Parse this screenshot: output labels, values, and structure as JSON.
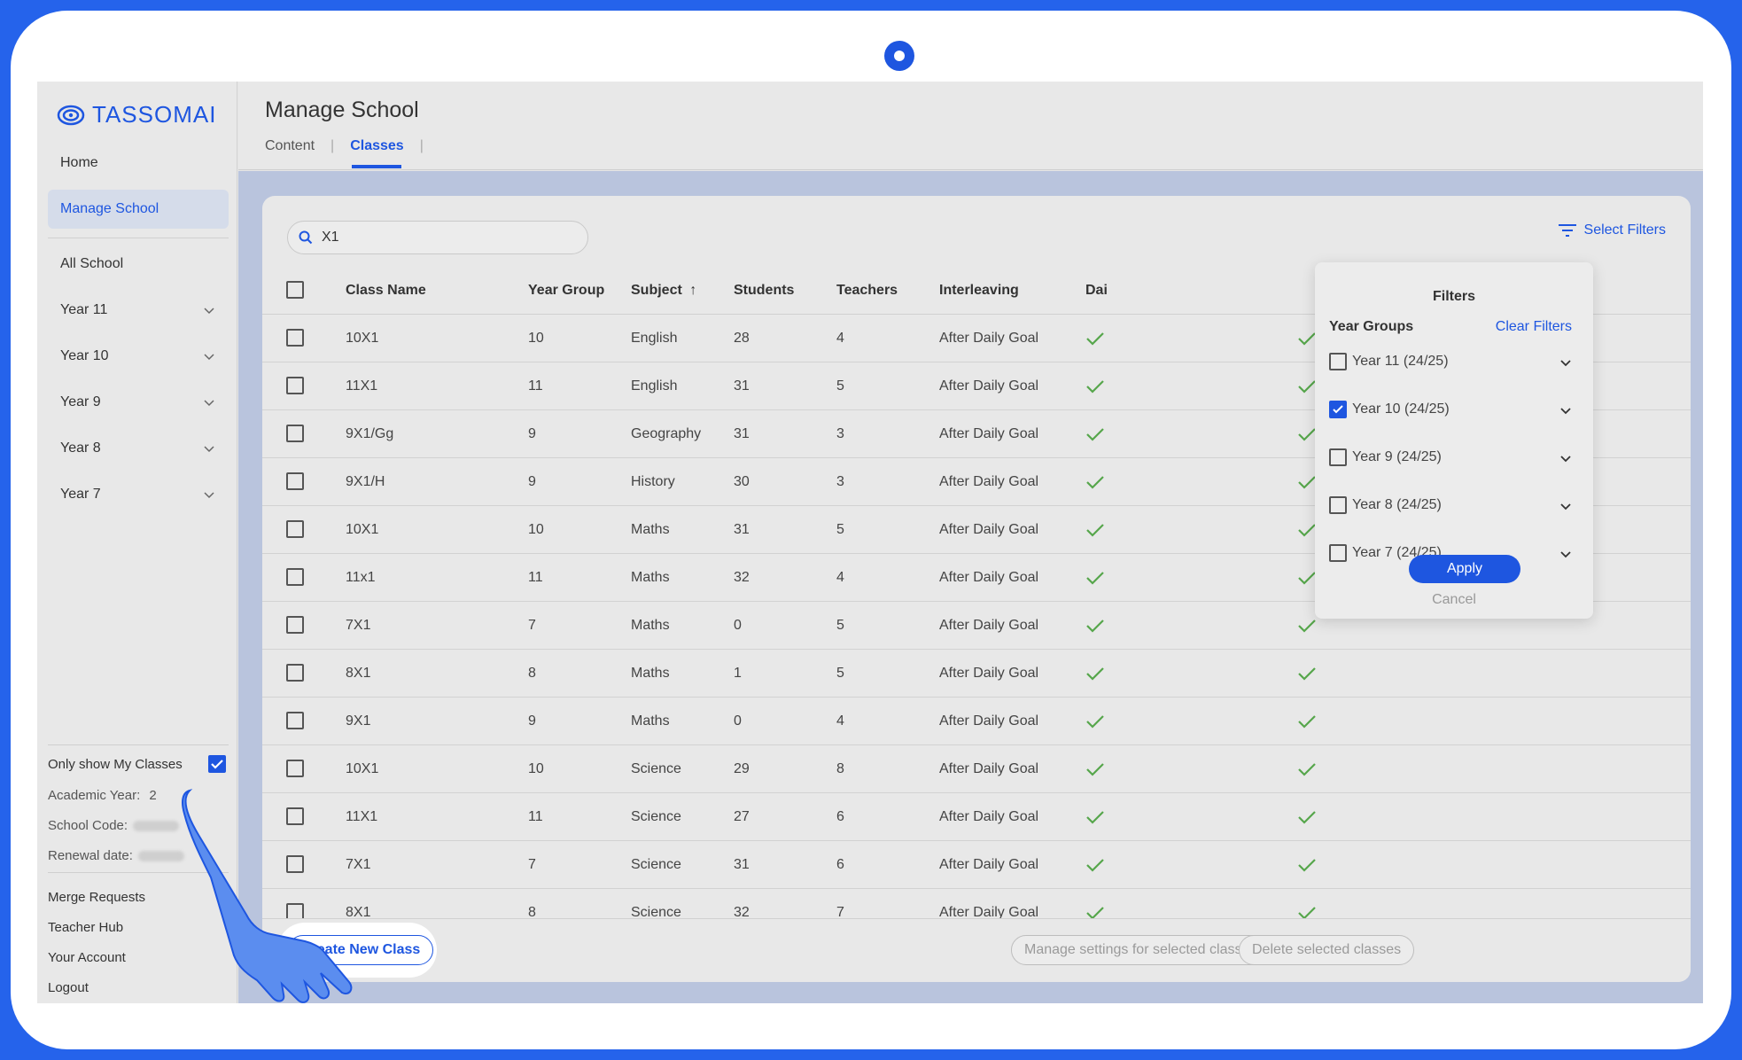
{
  "brand": {
    "name": "TASSOMAI",
    "accent": "#1e56e0"
  },
  "sidebar": {
    "home": "Home",
    "manage_school": "Manage School",
    "all_school": "All School",
    "years": [
      "Year 11",
      "Year 10",
      "Year 9",
      "Year 8",
      "Year 7"
    ],
    "only_my_classes": "Only show My Classes",
    "only_my_classes_checked": true,
    "academic_year_label": "Academic Year:",
    "academic_year_value": "2",
    "school_code_label": "School Code:",
    "renewal_date_label": "Renewal date:",
    "links": [
      "Merge Requests",
      "Teacher Hub",
      "Your Account",
      "Logout"
    ]
  },
  "header": {
    "title": "Manage School",
    "tabs": [
      {
        "label": "Content",
        "active": false
      },
      {
        "label": "Classes",
        "active": true
      }
    ]
  },
  "search": {
    "value": "X1"
  },
  "toolbar": {
    "select_filters": "Select Filters"
  },
  "table": {
    "columns": [
      "Class Name",
      "Year Group",
      "Subject",
      "Students",
      "Teachers",
      "Interleaving",
      "Dai"
    ],
    "sort_column": "Subject",
    "rows": [
      {
        "class": "10X1",
        "year": "10",
        "subject": "English",
        "students": "28",
        "teachers": "4",
        "interleaving": "After Daily Goal"
      },
      {
        "class": "11X1",
        "year": "11",
        "subject": "English",
        "students": "31",
        "teachers": "5",
        "interleaving": "After Daily Goal"
      },
      {
        "class": "9X1/Gg",
        "year": "9",
        "subject": "Geography",
        "students": "31",
        "teachers": "3",
        "interleaving": "After Daily Goal"
      },
      {
        "class": "9X1/H",
        "year": "9",
        "subject": "History",
        "students": "30",
        "teachers": "3",
        "interleaving": "After Daily Goal"
      },
      {
        "class": "10X1",
        "year": "10",
        "subject": "Maths",
        "students": "31",
        "teachers": "5",
        "interleaving": "After Daily Goal"
      },
      {
        "class": "11x1",
        "year": "11",
        "subject": "Maths",
        "students": "32",
        "teachers": "4",
        "interleaving": "After Daily Goal"
      },
      {
        "class": "7X1",
        "year": "7",
        "subject": "Maths",
        "students": "0",
        "teachers": "5",
        "interleaving": "After Daily Goal"
      },
      {
        "class": "8X1",
        "year": "8",
        "subject": "Maths",
        "students": "1",
        "teachers": "5",
        "interleaving": "After Daily Goal"
      },
      {
        "class": "9X1",
        "year": "9",
        "subject": "Maths",
        "students": "0",
        "teachers": "4",
        "interleaving": "After Daily Goal"
      },
      {
        "class": "10X1",
        "year": "10",
        "subject": "Science",
        "students": "29",
        "teachers": "8",
        "interleaving": "After Daily Goal"
      },
      {
        "class": "11X1",
        "year": "11",
        "subject": "Science",
        "students": "27",
        "teachers": "6",
        "interleaving": "After Daily Goal"
      },
      {
        "class": "7X1",
        "year": "7",
        "subject": "Science",
        "students": "31",
        "teachers": "6",
        "interleaving": "After Daily Goal"
      },
      {
        "class": "8X1",
        "year": "8",
        "subject": "Science",
        "students": "32",
        "teachers": "7",
        "interleaving": "After Daily Goal"
      }
    ]
  },
  "footer": {
    "create_new_class": "Create New Class",
    "manage_settings": "Manage settings for selected classes",
    "delete_selected": "Delete selected classes"
  },
  "filters": {
    "title": "Filters",
    "subtitle": "Year Groups",
    "clear": "Clear Filters",
    "options": [
      {
        "label": "Year 11 (24/25)",
        "checked": false
      },
      {
        "label": "Year 10 (24/25)",
        "checked": true
      },
      {
        "label": "Year 9 (24/25)",
        "checked": false
      },
      {
        "label": "Year 8 (24/25)",
        "checked": false
      },
      {
        "label": "Year 7 (24/25)",
        "checked": false
      }
    ],
    "apply": "Apply",
    "cancel": "Cancel"
  }
}
